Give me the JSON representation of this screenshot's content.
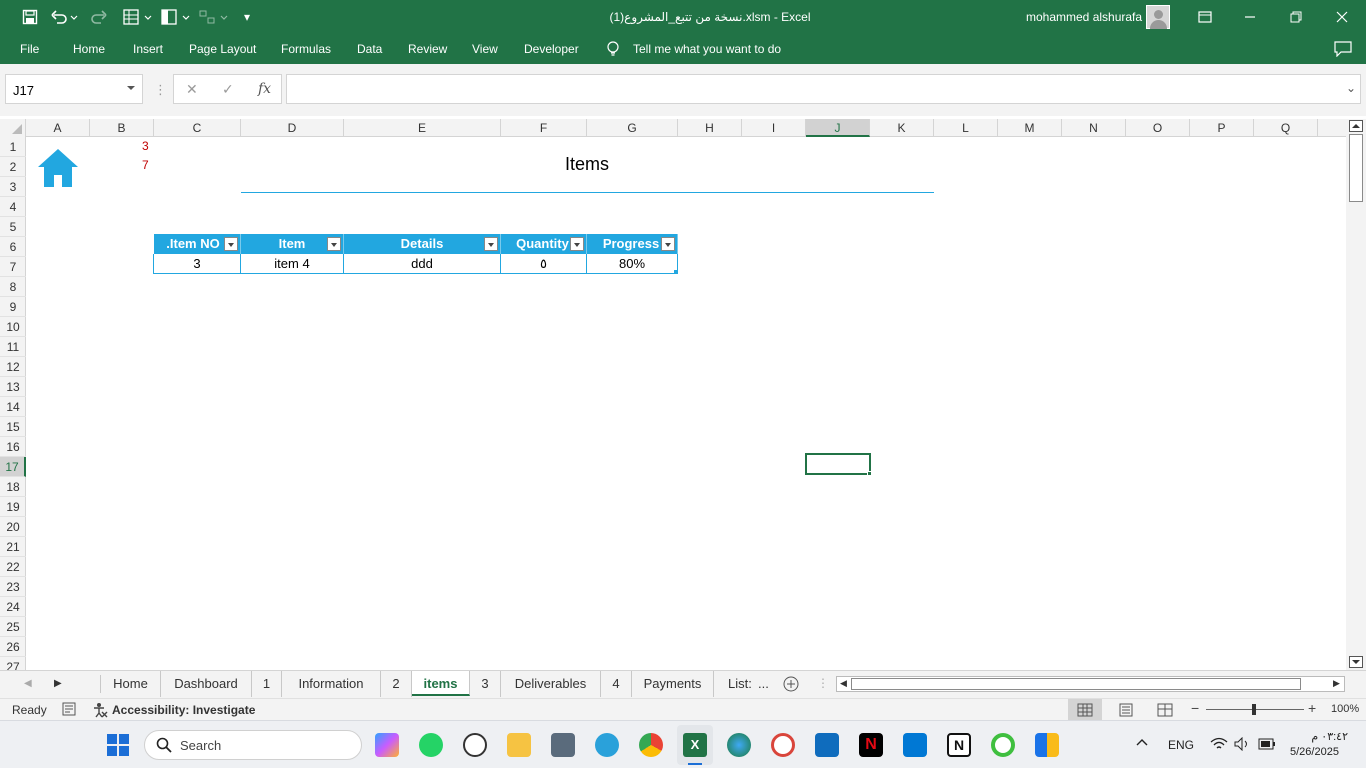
{
  "window": {
    "title": "نسخة من تتبع_المشروع(1).xlsm  -  Excel",
    "user": "mohammed alshurafa"
  },
  "menu": [
    "File",
    "Home",
    "Insert",
    "Page Layout",
    "Formulas",
    "Data",
    "Review",
    "View",
    "Developer"
  ],
  "tell_me": "Tell me what you want to do",
  "formula_bar": {
    "name_box": "J17",
    "cancel_icon": "✕",
    "enter_icon": "✓",
    "fx_label": "fx",
    "formula": ""
  },
  "columns": [
    "A",
    "B",
    "C",
    "D",
    "E",
    "F",
    "G",
    "H",
    "I",
    "J",
    "K",
    "L",
    "M",
    "N",
    "O",
    "P",
    "Q"
  ],
  "rows": [
    "1",
    "2",
    "3",
    "4",
    "5",
    "6",
    "7",
    "8",
    "9",
    "10",
    "11",
    "12",
    "13",
    "14",
    "15",
    "16",
    "17",
    "18",
    "19",
    "20",
    "21",
    "22",
    "23",
    "24",
    "25",
    "26",
    "27"
  ],
  "cells": {
    "b1": "3",
    "b2": "7",
    "sheet_title": "Items"
  },
  "table": {
    "headers": [
      ".Item NO",
      "Item",
      "Details",
      "Quantity",
      "Progress"
    ],
    "rows": [
      [
        "3",
        "item 4",
        "ddd",
        "٥",
        "80%"
      ]
    ]
  },
  "sheet_tabs": [
    "Home",
    "Dashboard",
    "1",
    "Information",
    "2",
    "items",
    "3",
    "Deliverables",
    "4",
    "Payments",
    "List:"
  ],
  "active_tab": "items",
  "tabs_overflow": "...",
  "status": {
    "ready": "Ready",
    "accessibility": "Accessibility: Investigate",
    "zoom": "100%"
  },
  "taskbar": {
    "search_placeholder": "Search",
    "language": "ENG",
    "time": "٠٣:٤٢ م",
    "date": "5/26/2025"
  },
  "colors": {
    "excel_green": "#217346",
    "table_header": "#22a7e0",
    "home_icon": "#22a7e0",
    "accent_red": "#c00000"
  }
}
